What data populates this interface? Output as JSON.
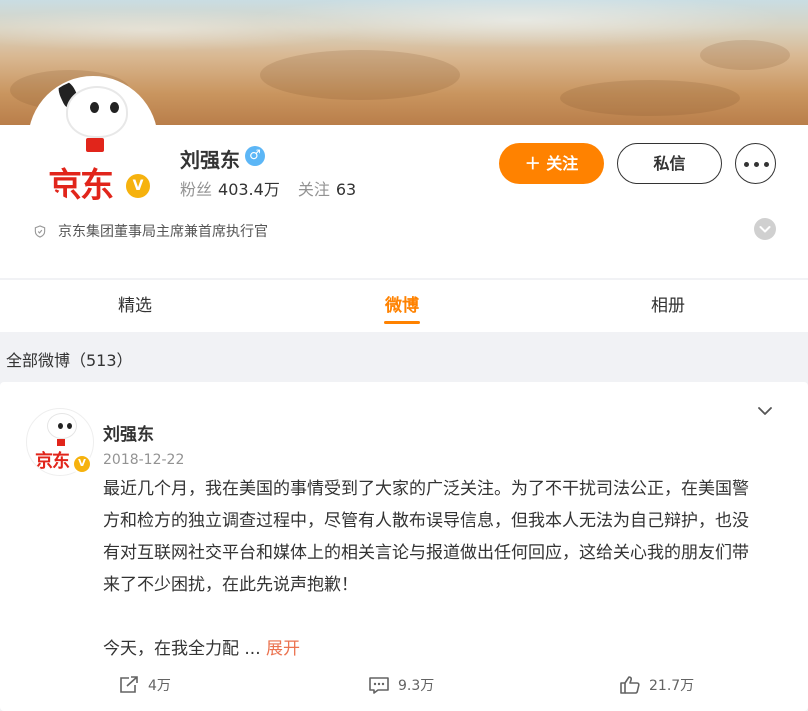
{
  "profile": {
    "name": "刘强东",
    "avatar_text": "京东",
    "verified_badge": "V",
    "gender_symbol": "♂",
    "fans_label": "粉丝",
    "fans_count": "403.4万",
    "follow_label": "关注",
    "follow_count": "63",
    "bio": "京东集团董事局主席兼首席执行官",
    "follow_button": "＋ 关注",
    "message_button": "私信"
  },
  "tabs": [
    {
      "label": "精选",
      "active": false
    },
    {
      "label": "微博",
      "active": true
    },
    {
      "label": "相册",
      "active": false
    }
  ],
  "feed": {
    "section_title": "全部微博（513）"
  },
  "post": {
    "author": "刘强东",
    "avatar_text": "京东",
    "date": "2018-12-22",
    "text_lines": [
      "最近几个月，我在美国的事情受到了大家的广泛关注。为了不干扰司法公正，在美国警",
      "方和检方的独立调查过程中，尽管有人散布误导信息，但我本人无法为自己辩护，也没",
      "有对互联网社交平台和媒体上的相关言论与报道做出任何回应，这给关心我的朋友们带",
      "来了不少困扰，在此先说声抱歉！"
    ],
    "text_tail": "今天，在我全力配 ...",
    "expand_label": "展开",
    "repost_count": "4万",
    "comment_count": "9.3万",
    "like_count": "21.7万"
  },
  "colors": {
    "accent": "#ff8200",
    "link": "#eb7350",
    "gold_badge": "#f6b20e",
    "brand_red": "#e1251b"
  },
  "icons": [
    "gender-male-icon",
    "shield-icon",
    "chevron-down-icon",
    "more-dots-icon",
    "repost-icon",
    "comment-icon",
    "like-icon"
  ]
}
